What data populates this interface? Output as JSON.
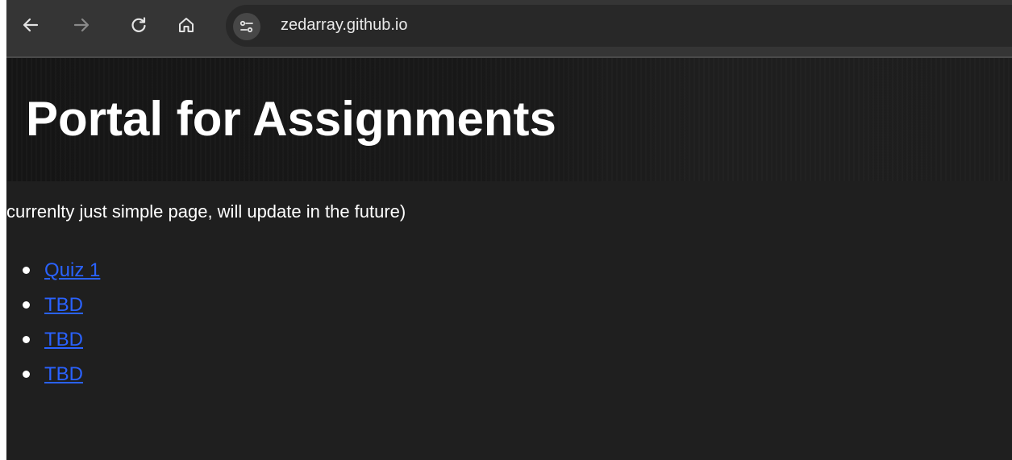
{
  "browser": {
    "url": "zedarray.github.io",
    "icons": {
      "back": "back-arrow-icon",
      "forward": "forward-arrow-icon",
      "reload": "reload-icon",
      "home": "home-icon",
      "site_info": "tune-icon"
    }
  },
  "page": {
    "title": "Portal for Assignments",
    "subtitle": "currenlty just simple page, will update in the future)",
    "links": [
      {
        "label": "Quiz 1"
      },
      {
        "label": "TBD"
      },
      {
        "label": "TBD"
      },
      {
        "label": "TBD"
      }
    ]
  },
  "colors": {
    "background": "#1f1f1f",
    "toolbar": "#353535",
    "link": "#2a62ff",
    "text": "#ffffff"
  }
}
